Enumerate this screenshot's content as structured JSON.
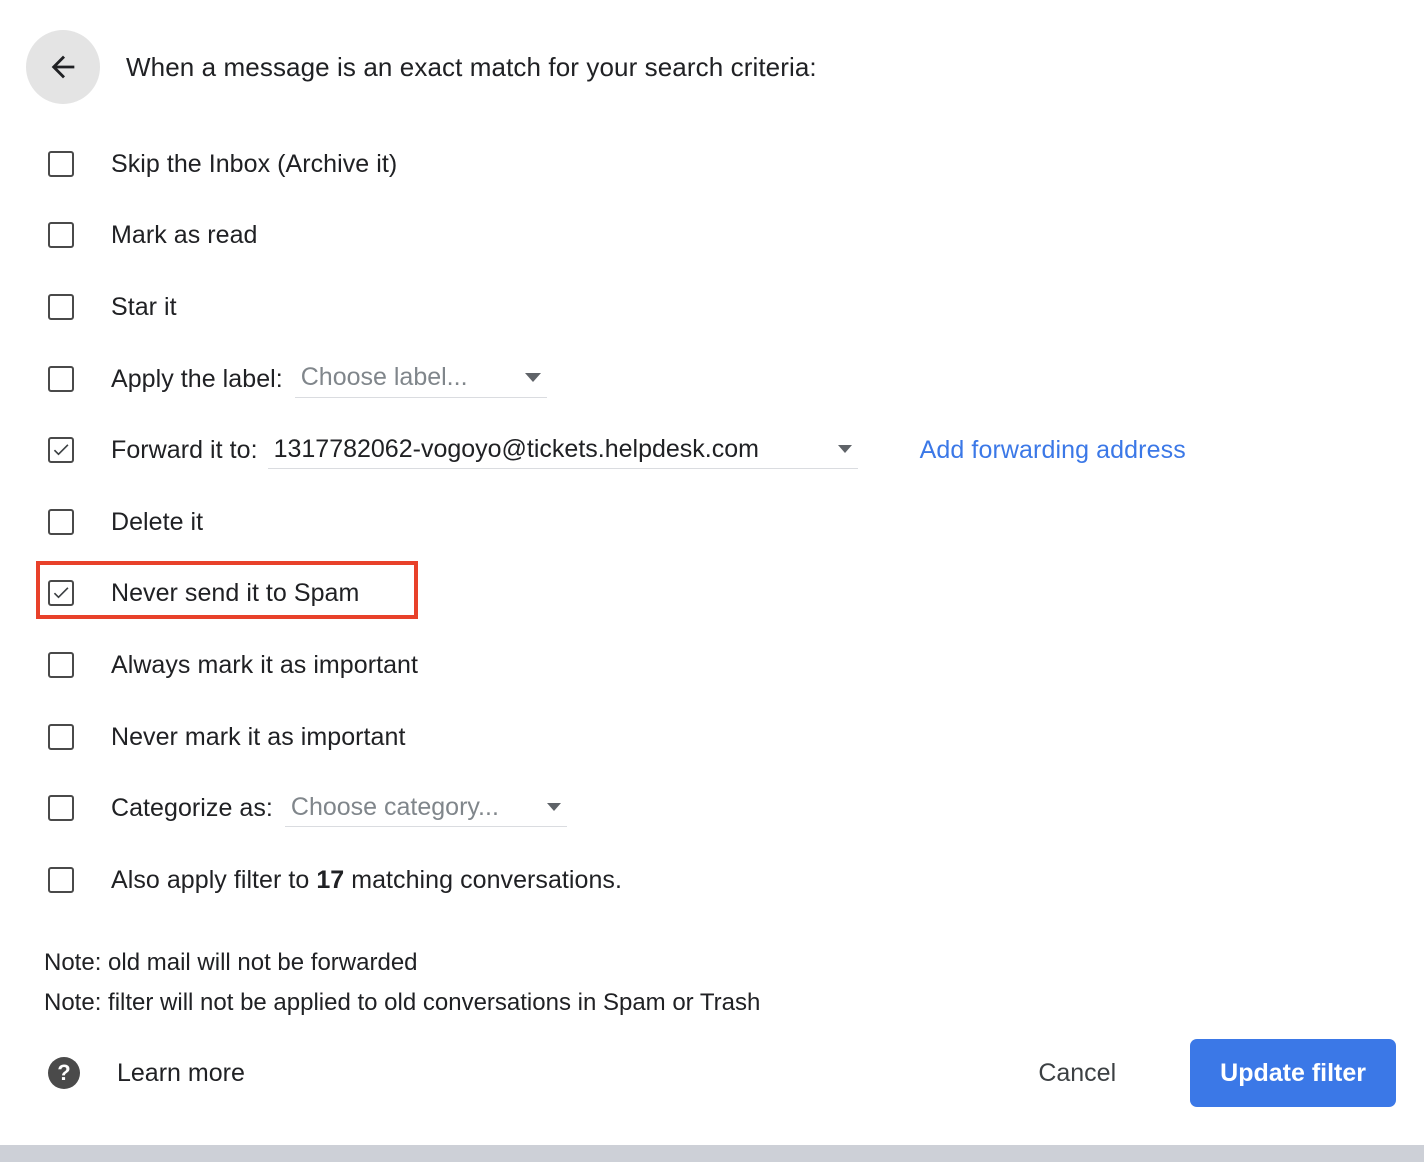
{
  "header": {
    "back_icon": "arrow-left-icon",
    "title": "When a message is an exact match for your search criteria:"
  },
  "options": [
    {
      "label": "Skip the Inbox (Archive it)",
      "checked": false
    },
    {
      "label": "Mark as read",
      "checked": false
    },
    {
      "label": "Star it",
      "checked": false
    },
    {
      "label": "Apply the label:",
      "checked": false,
      "select_value": "Choose label...",
      "select_placeholder": true
    },
    {
      "label": "Forward it to:",
      "checked": true,
      "select_value": "1317782062-vogoyo@tickets.helpdesk.com",
      "select_placeholder": false,
      "link": "Add forwarding address"
    },
    {
      "label": "Delete it",
      "checked": false
    },
    {
      "label": "Never send it to Spam",
      "checked": true,
      "highlighted": true
    },
    {
      "label": "Always mark it as important",
      "checked": false
    },
    {
      "label": "Never mark it as important",
      "checked": false
    },
    {
      "label": "Categorize as:",
      "checked": false,
      "select_value": "Choose category...",
      "select_placeholder": true
    },
    {
      "label_pre": "Also apply filter to ",
      "label_bold": "17",
      "label_post": " matching conversations.",
      "checked": false
    }
  ],
  "notes": [
    "Note: old mail will not be forwarded",
    "Note: filter will not be applied to old conversations in Spam or Trash"
  ],
  "footer": {
    "help_icon": "help-question-icon",
    "learn_more": "Learn more",
    "cancel_label": "Cancel",
    "update_label": "Update filter"
  },
  "colors": {
    "accent_blue": "#3b78e7",
    "highlight_red": "#e8412a",
    "text_primary": "#202124",
    "text_muted": "#80868b"
  }
}
